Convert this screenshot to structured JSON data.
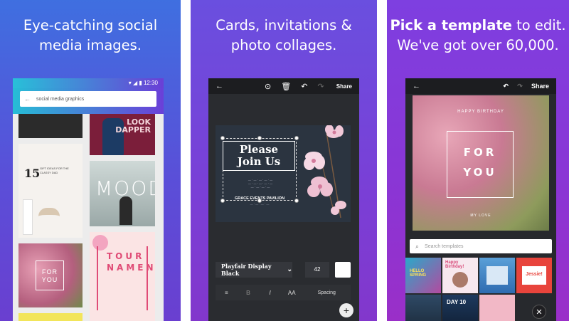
{
  "panels": [
    {
      "caption_line1": "Eye-catching social",
      "caption_line2": "media images.",
      "status_time": "12:30",
      "search_value": "social media graphics",
      "tiles": {
        "look_dapper": "LOOK\nDAPPER",
        "gift_number": "15",
        "gift_text": "GIFT IDEAS FOR THE CLASSY DAD",
        "mood": "MOOD",
        "for_you": "FOR\nYOU",
        "tournament": "TOUR\nNAMENT"
      }
    },
    {
      "caption_line1": "Cards, invitations &",
      "caption_line2": "photo collages.",
      "toolbar": {
        "share_label": "Share"
      },
      "card": {
        "title": "Please\nJoin Us",
        "event": "GRACE EVENTS PAVILION"
      },
      "font_name": "Playfair Display Black",
      "font_size": "42",
      "format": {
        "align": "≡",
        "bold": "B",
        "italic": "I",
        "caps": "AA",
        "spacing": "Spacing"
      },
      "fab": "+"
    },
    {
      "caption_bold": "Pick a template",
      "caption_rest": " to edit.",
      "caption_line2": "We've got over 60,000.",
      "toolbar": {
        "share_label": "Share"
      },
      "card": {
        "happy_birthday": "HAPPY BIRTHDAY",
        "for": "FOR",
        "you": "YOU",
        "my_love": "MY LOVE"
      },
      "search_placeholder": "Search templates",
      "thumbs": [
        "HELLO SPRING",
        "Happy Birthday!",
        "",
        "Jessie!",
        "",
        "DAY 10",
        "",
        ""
      ],
      "close": "✕"
    }
  ],
  "colors": {
    "accent_pink": "#e04b76",
    "editor_bg": "#2a2c30"
  }
}
